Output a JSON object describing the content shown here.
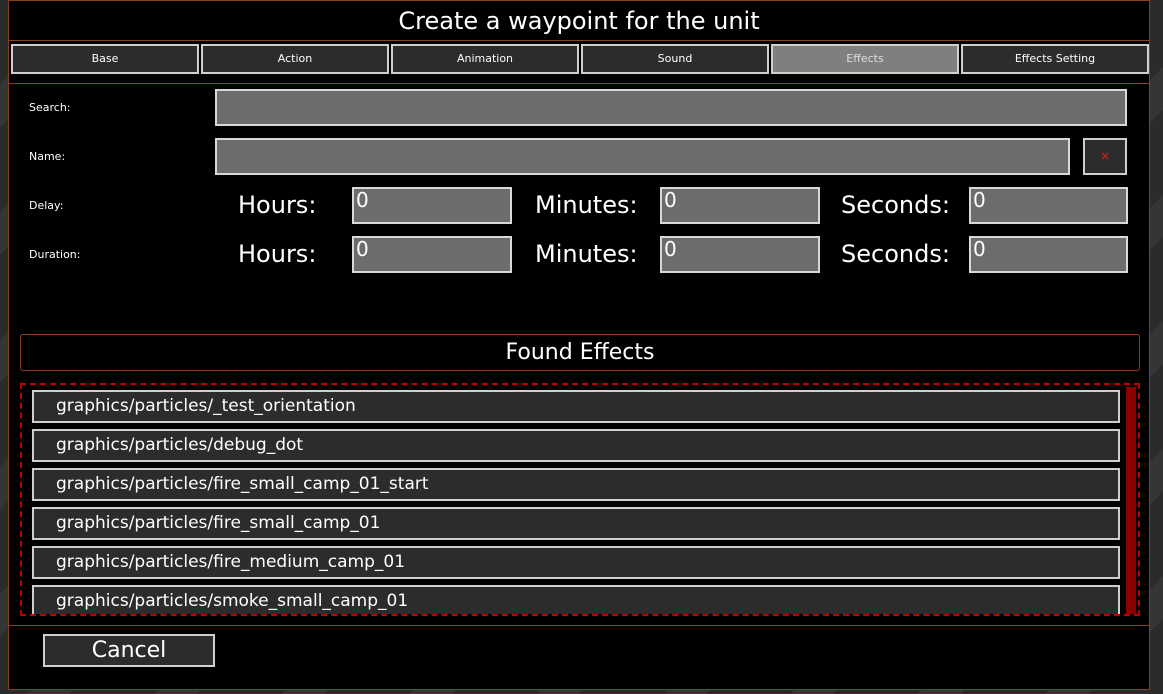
{
  "window": {
    "title": "Create a waypoint for the unit"
  },
  "tabs": [
    {
      "label": "Base"
    },
    {
      "label": "Action"
    },
    {
      "label": "Animation"
    },
    {
      "label": "Sound"
    },
    {
      "label": "Effects",
      "active": true
    },
    {
      "label": "Effects Setting"
    }
  ],
  "form": {
    "search_label": "Search:",
    "search_value": "",
    "name_label": "Name:",
    "name_value": "",
    "clear_icon": "×",
    "delay_label": "Delay:",
    "duration_label": "Duration:",
    "hours_label": "Hours:",
    "minutes_label": "Minutes:",
    "seconds_label": "Seconds:",
    "delay": {
      "hours": "0",
      "minutes": "0",
      "seconds": "0"
    },
    "duration": {
      "hours": "0",
      "minutes": "0",
      "seconds": "0"
    }
  },
  "found": {
    "header": "Found Effects",
    "items": [
      "graphics/particles/_test_orientation",
      "graphics/particles/debug_dot",
      "graphics/particles/fire_small_camp_01_start",
      "graphics/particles/fire_small_camp_01",
      "graphics/particles/fire_medium_camp_01",
      "graphics/particles/smoke_small_camp_01"
    ]
  },
  "footer": {
    "cancel_label": "Cancel"
  },
  "colors": {
    "accent_border": "#8a3e20",
    "scrollbar": "#8b0000",
    "field_bg": "#6c6c6c"
  }
}
